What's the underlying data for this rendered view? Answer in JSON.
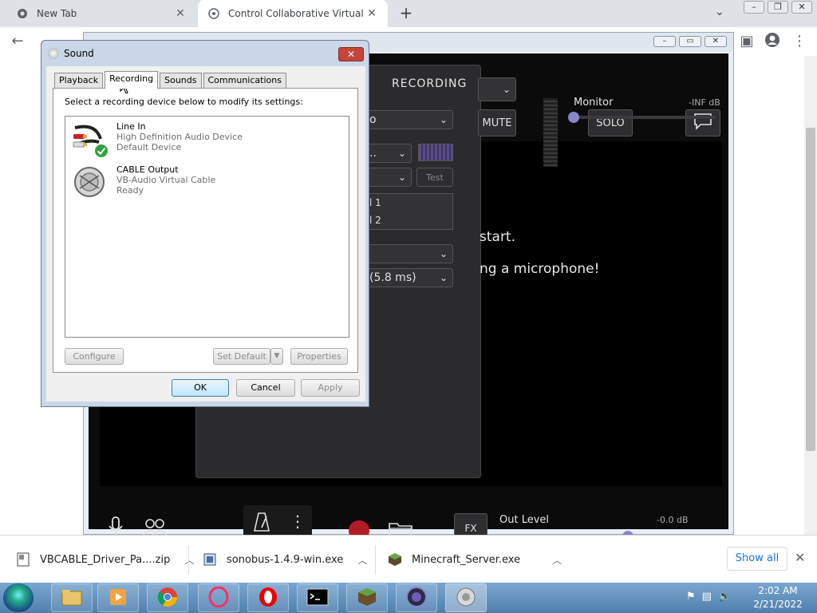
{
  "browser": {
    "tabs": [
      {
        "title": "New Tab",
        "active": false
      },
      {
        "title": "Control Collaborative Virtual Ma",
        "active": true
      }
    ],
    "new_tab_symbol": "+",
    "scrollbar_position": 0.15
  },
  "sonobus": {
    "recording_label": "RECORDING",
    "input_partial": "o",
    "input_dropdown_partial": "..",
    "channel_lines": [
      "l 1",
      "l 2"
    ],
    "buffer_partial": "(5.8 ms)",
    "test_label": "Test",
    "mute_label": "MUTE",
    "solo_label": "SOLO",
    "monitor_label": "Monitor",
    "monitor_db": "-INF dB",
    "monitor_level": 0.0,
    "messages": [
      "start.",
      "ng a microphone!"
    ],
    "fx_label": "FX",
    "out_level_label": "Out Level",
    "out_level_db": "-0.0 dB",
    "out_level_value": 0.7
  },
  "sound_dialog": {
    "title": "Sound",
    "tabs": [
      "Playback",
      "Recording",
      "Sounds",
      "Communications"
    ],
    "selected_tab": "Recording",
    "instruction": "Select a recording device below to modify its settings:",
    "devices": [
      {
        "name": "Line In",
        "line1": "High Definition Audio Device",
        "line2": "Default Device",
        "default": true
      },
      {
        "name": "CABLE Output",
        "line1": "VB-Audio Virtual Cable",
        "line2": "Ready",
        "default": false
      }
    ],
    "buttons": {
      "configure": "Configure",
      "set_default": "Set Default",
      "properties": "Properties",
      "ok": "OK",
      "cancel": "Cancel",
      "apply": "Apply"
    }
  },
  "downloads": {
    "items": [
      {
        "name": "VBCABLE_Driver_Pa....zip"
      },
      {
        "name": "sonobus-1.4.9-win.exe"
      },
      {
        "name": "Minecraft_Server.exe"
      }
    ],
    "show_all": "Show all"
  },
  "taskbar": {
    "apps": [
      "explorer",
      "media-player",
      "chrome",
      "opera-gx",
      "opera",
      "cmd",
      "minecraft",
      "sonobus",
      "sound"
    ],
    "clock_time": "2:02 AM",
    "clock_date": "2/21/2022"
  },
  "colors": {
    "sonobus_bg": "#0b0b0b",
    "record_red": "#b01e23",
    "slider_knob": "#8a86c8",
    "link_blue": "#1a73e8",
    "close_red": "#c6443a"
  }
}
